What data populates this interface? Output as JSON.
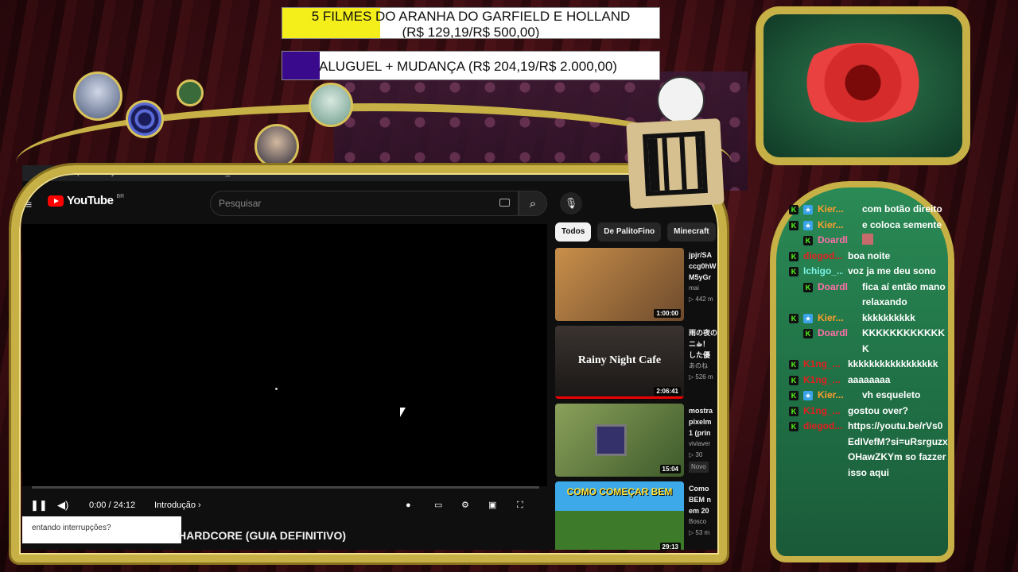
{
  "goals": [
    {
      "title": "5 FILMES DO ARANHA DO GARFIELD E HOLLAND",
      "amount": "(R$ 129,19/R$ 500,00)",
      "progress": 0.26,
      "color": "#f4ef1b"
    },
    {
      "title": "ALUGUEL + MUDANÇA (R$ 204,19/R$ 2.000,00)",
      "progress": 0.1,
      "color": "#3a0a8c"
    }
  ],
  "browser": {
    "url_prefix": "https://",
    "url": "www.youtube.com/watch?v=5YbmKm_r58o"
  },
  "youtube": {
    "logo": "YouTube",
    "country": "BR",
    "search_placeholder": "Pesquisar",
    "time": "0:00 / 24:12",
    "chapter": "Introdução",
    "tooltip": "entando interrupções?",
    "video_title": "HARDCORE (GUIA DEFINITIVO)",
    "chips": [
      "Todos",
      "De PalitoFino",
      "Minecraft"
    ],
    "recommendations": [
      {
        "title_lines": [
          "jpjr/SA",
          "ccg0hW",
          "M5yGr"
        ],
        "channel": "mai",
        "views": "▷ 442 m",
        "duration": "1:00:00",
        "thumb_text": "",
        "thumb_colors": [
          "#c98f4a",
          "#6d4a2c"
        ]
      },
      {
        "title_lines": [
          "雨の夜の",
          "ニ☕︎！",
          "した優"
        ],
        "channel": "あのね",
        "views": "▷ 526 m",
        "duration": "2:06:41",
        "thumb_text": "Rainy Night Cafe",
        "thumb_colors": [
          "#3a3330",
          "#1a1716"
        ]
      },
      {
        "title_lines": [
          "mostra",
          "pixelm",
          "1 (prin"
        ],
        "channel": "viviaver",
        "views": "▷ 30",
        "duration": "15:04",
        "badge": "Novo",
        "thumb_text": "",
        "thumb_colors": [
          "#6c8a4a",
          "#3d5a2a"
        ]
      },
      {
        "title_lines": [
          "Como",
          "BEM n",
          "em 20"
        ],
        "channel": "Bosco",
        "views": "▷ 53 m",
        "duration": "29:13",
        "thumb_text": "COMO COMEÇAR BEM",
        "thumb_colors": [
          "#3da9e8",
          "#3d7a2a"
        ]
      }
    ]
  },
  "chat": [
    {
      "user": "Kier...",
      "color": "#ff9d2e",
      "sub": true,
      "msg": "com botão direito"
    },
    {
      "user": "Kier...",
      "color": "#ff9d2e",
      "sub": true,
      "msg": "e coloca semente"
    },
    {
      "user": "Doardl",
      "color": "#ff6fa8",
      "indent": true,
      "msg": "",
      "emote": true
    },
    {
      "user": "diegod...",
      "color": "#e02020",
      "msg": "boa noite"
    },
    {
      "user": "Ichigo_...",
      "color": "#7df2e8",
      "msg": "voz ja me deu sono"
    },
    {
      "user": "Doardl",
      "color": "#ff6fa8",
      "indent": true,
      "msg": "fica aí então mano relaxando"
    },
    {
      "user": "Kier...",
      "color": "#ff9d2e",
      "sub": true,
      "msg": "kkkkkkkkkk"
    },
    {
      "user": "Doardl",
      "color": "#ff6fa8",
      "indent": true,
      "msg": "KKKKKKKKKKKKK"
    },
    {
      "user": "K1ng_...",
      "color": "#e02020",
      "msg": "kkkkkkkkkkkkkkkkk"
    },
    {
      "user": "K1ng_...",
      "color": "#e02020",
      "msg": "aaaaaaaa"
    },
    {
      "user": "Kier...",
      "color": "#ff9d2e",
      "sub": true,
      "msg": "vh esqueleto"
    },
    {
      "user": "K1ng_...",
      "color": "#e02020",
      "msg": "gostou over?"
    },
    {
      "user": "diegod...",
      "color": "#e02020",
      "msg": "https://youtu.be/rVs0EdIVefM?si=uRsrguzxOHawZKYm so fazzer isso aqui"
    }
  ]
}
